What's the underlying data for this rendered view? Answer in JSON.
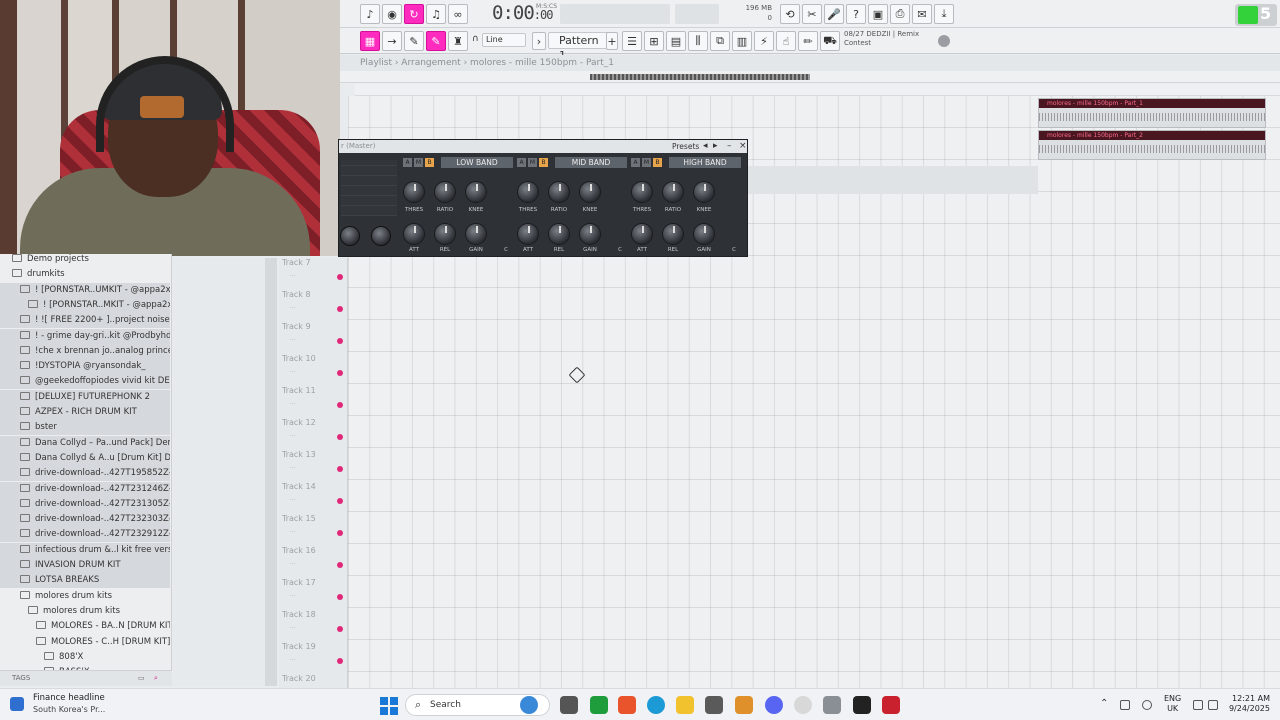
{
  "toolbar": {
    "time": "0:00",
    "time_sub": ":00",
    "time_unit": "M:S:CS",
    "mem_value": "196 MB",
    "mem_sub": "0",
    "snap_label": "Line",
    "pattern_label": "Pattern 1",
    "hint_line1": "08/27  DEDZII | Remix",
    "hint_line2": "Contest",
    "badge": "5"
  },
  "playlist": {
    "breadcrumb": "Playlist › Arrangement › molores - mille 150bpm - Part_1",
    "clips": [
      {
        "title": "molores - mille 150bpm - Part_1"
      },
      {
        "title": "molores - mille 150bpm - Part_2"
      }
    ],
    "tracks": [
      "Track 7",
      "Track 8",
      "Track 9",
      "Track 10",
      "Track 11",
      "Track 12",
      "Track 13",
      "Track 14",
      "Track 15",
      "Track 16",
      "Track 17",
      "Track 18",
      "Track 19",
      "Track 20"
    ],
    "track_dots": "..."
  },
  "plugin": {
    "title": "r (Master)",
    "presets": "Presets",
    "bands": [
      {
        "name": "LOW BAND"
      },
      {
        "name": "MID BAND"
      },
      {
        "name": "HIGH BAND"
      }
    ],
    "abc": [
      "A",
      "M",
      "B"
    ],
    "knob_labels_top": [
      "THRES",
      "RATIO",
      "KNEE"
    ],
    "knob_labels_bottom": [
      "ATT",
      "REL",
      "GAIN"
    ],
    "band_flag": "C"
  },
  "browser": {
    "items": [
      {
        "label": "Demo projects",
        "indent": 1
      },
      {
        "label": "drumkits",
        "indent": 1
      },
      {
        "label": "!    [PORNSTAR..UMKIT - @appa2x",
        "indent": 2
      },
      {
        "label": "!    [PORNSTAR..MKIT - @appa2x",
        "indent": 3
      },
      {
        "label": "! ![ FREE 2200+ ]..project noise)!  !",
        "indent": 2
      },
      {
        "label": "! - grime day-gri..kit @Prodbyhdotty",
        "indent": 2
      },
      {
        "label": "!che x brennan jo..analog princess)",
        "indent": 2
      },
      {
        "label": "!DYSTOPIA @ryansondak_",
        "indent": 2
      },
      {
        "label": "@geekedoffopiodes vivid kit DEMO",
        "indent": 2
      },
      {
        "label": "[DELUXE] FUTUREPHONK 2",
        "indent": 2
      },
      {
        "label": "AZPEX - RICH DRUM KIT",
        "indent": 2
      },
      {
        "label": "bster",
        "indent": 2
      },
      {
        "label": "Dana Collyd – Pa..und Pack] Demo",
        "indent": 2
      },
      {
        "label": "Dana Collyd & A..u [Drum Kit] Demo",
        "indent": 2
      },
      {
        "label": "drive-download-..427T195852Z-001",
        "indent": 2
      },
      {
        "label": "drive-download-..427T231246Z-001",
        "indent": 2
      },
      {
        "label": "drive-download-..427T231305Z-001",
        "indent": 2
      },
      {
        "label": "drive-download-..427T232303Z-001",
        "indent": 2
      },
      {
        "label": "drive-download-..427T232912Z-001",
        "indent": 2
      },
      {
        "label": "infectious drum &..l kit free version",
        "indent": 2
      },
      {
        "label": "INVASION DRUM KIT",
        "indent": 2
      },
      {
        "label": "LOTSA BREAKS",
        "indent": 2
      },
      {
        "label": "molores drum kits",
        "indent": 2
      },
      {
        "label": "molores drum kits",
        "indent": 3
      },
      {
        "label": "MOLORES - BA..N [DRUM KIT]",
        "indent": 4
      },
      {
        "label": "MOLORES - C..H [DRUM KIT]",
        "indent": 4
      },
      {
        "label": "808'X",
        "indent": 5
      },
      {
        "label": "BASS'X",
        "indent": 5
      }
    ],
    "footer": "TAGS"
  },
  "taskbar": {
    "news_title": "Finance headline",
    "news_sub": "South Korea's Pr...",
    "search": "Search",
    "lang1": "ENG",
    "lang2": "UK",
    "time": "12:21 AM",
    "date": "9/24/2025"
  },
  "colors": {
    "accent_pink": "#ff2bbf",
    "clip_title_bg": "#4a1620",
    "track_dot": "#e0287a",
    "band_active": "#e8a44a"
  }
}
